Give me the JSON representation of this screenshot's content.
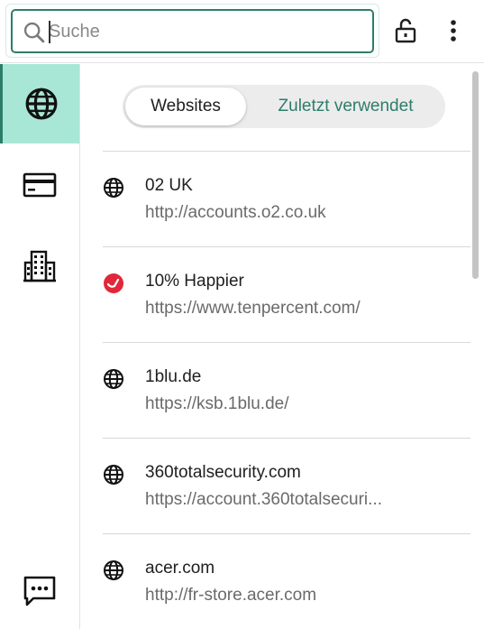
{
  "search": {
    "placeholder": "Suche",
    "value": ""
  },
  "header": {
    "lock_icon": "lock-open-icon",
    "menu_icon": "more-vertical-icon"
  },
  "sidebar": {
    "items": [
      {
        "name": "websites",
        "icon": "globe-icon",
        "active": true
      },
      {
        "name": "cards",
        "icon": "credit-card-icon",
        "active": false
      },
      {
        "name": "companies",
        "icon": "building-icon",
        "active": false
      }
    ],
    "feedback_icon": "chat-feedback-icon"
  },
  "toggle": {
    "selected": "Websites",
    "other": "Zuletzt verwendet"
  },
  "items": [
    {
      "title": "02 UK",
      "url": "http://accounts.o2.co.uk",
      "icon": "globe-icon"
    },
    {
      "title": "10% Happier",
      "url": "https://www.tenpercent.com/",
      "icon": "tenpercent-logo-icon"
    },
    {
      "title": "1blu.de",
      "url": "https://ksb.1blu.de/",
      "icon": "globe-icon"
    },
    {
      "title": "360totalsecurity.com",
      "url": "https://account.360totalsecuri...",
      "icon": "globe-icon"
    },
    {
      "title": "acer.com",
      "url": "http://fr-store.acer.com",
      "icon": "globe-icon"
    }
  ],
  "colors": {
    "accent": "#2e7d6a",
    "active_bg": "#a8e6d6",
    "logo_red": "#e0283a"
  }
}
